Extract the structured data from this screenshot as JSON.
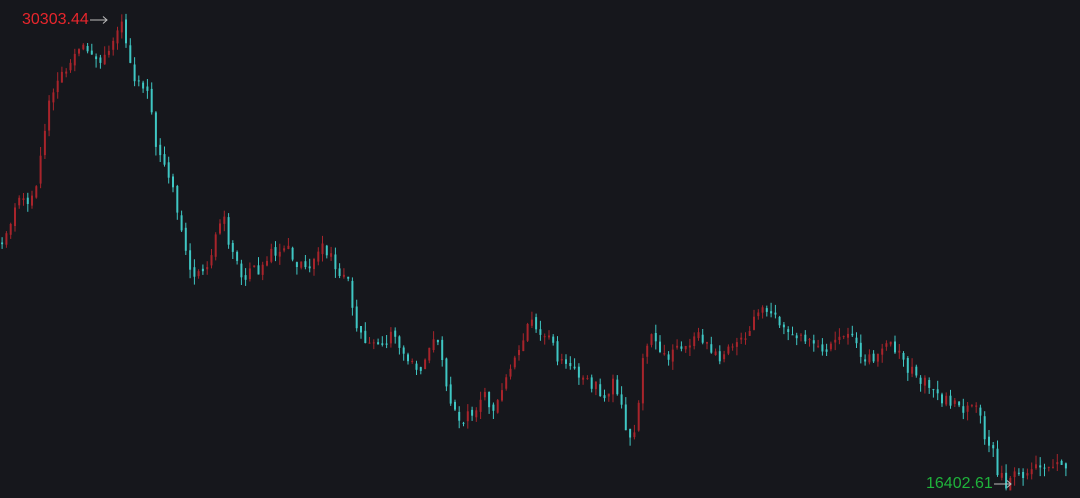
{
  "colors": {
    "background": "#16171c",
    "up": "#a8242b",
    "down": "#3fc7c4",
    "max_label": "#e8262c",
    "min_label": "#1fb33b",
    "arrow": "#bdbdbd"
  },
  "chart_data": {
    "type": "candlestick",
    "title": "",
    "xlabel": "",
    "ylabel": "",
    "grid": false,
    "axes_visible": false,
    "ylim": [
      16000,
      30600
    ],
    "max_label": "30303.44",
    "min_label": "16402.61",
    "close_path": [
      [
        0.0,
        23600
      ],
      [
        0.01,
        24300
      ],
      [
        0.018,
        25200
      ],
      [
        0.025,
        24700
      ],
      [
        0.033,
        25500
      ],
      [
        0.042,
        27600
      ],
      [
        0.05,
        28200
      ],
      [
        0.058,
        28700
      ],
      [
        0.066,
        29100
      ],
      [
        0.074,
        29500
      ],
      [
        0.082,
        29150
      ],
      [
        0.09,
        28900
      ],
      [
        0.098,
        29400
      ],
      [
        0.106,
        29900
      ],
      [
        0.112,
        30250
      ],
      [
        0.118,
        29300
      ],
      [
        0.124,
        28600
      ],
      [
        0.132,
        28400
      ],
      [
        0.14,
        27700
      ],
      [
        0.146,
        26400
      ],
      [
        0.152,
        26200
      ],
      [
        0.16,
        25400
      ],
      [
        0.168,
        24200
      ],
      [
        0.176,
        23100
      ],
      [
        0.184,
        22600
      ],
      [
        0.192,
        22900
      ],
      [
        0.2,
        23800
      ],
      [
        0.208,
        24400
      ],
      [
        0.216,
        23300
      ],
      [
        0.226,
        22700
      ],
      [
        0.238,
        22800
      ],
      [
        0.25,
        23200
      ],
      [
        0.262,
        23500
      ],
      [
        0.272,
        23300
      ],
      [
        0.282,
        22900
      ],
      [
        0.292,
        23100
      ],
      [
        0.3,
        23600
      ],
      [
        0.308,
        23200
      ],
      [
        0.316,
        22800
      ],
      [
        0.324,
        22600
      ],
      [
        0.332,
        21400
      ],
      [
        0.34,
        20800
      ],
      [
        0.352,
        20600
      ],
      [
        0.366,
        20900
      ],
      [
        0.378,
        20300
      ],
      [
        0.388,
        19800
      ],
      [
        0.398,
        20100
      ],
      [
        0.408,
        20800
      ],
      [
        0.416,
        19600
      ],
      [
        0.424,
        18600
      ],
      [
        0.432,
        18200
      ],
      [
        0.442,
        18700
      ],
      [
        0.452,
        19100
      ],
      [
        0.462,
        18800
      ],
      [
        0.472,
        19400
      ],
      [
        0.482,
        20200
      ],
      [
        0.49,
        20800
      ],
      [
        0.498,
        21300
      ],
      [
        0.506,
        21100
      ],
      [
        0.514,
        20700
      ],
      [
        0.524,
        20200
      ],
      [
        0.534,
        19800
      ],
      [
        0.544,
        19600
      ],
      [
        0.556,
        19400
      ],
      [
        0.568,
        19200
      ],
      [
        0.576,
        19700
      ],
      [
        0.584,
        18400
      ],
      [
        0.59,
        17600
      ],
      [
        0.596,
        18300
      ],
      [
        0.604,
        20600
      ],
      [
        0.612,
        20900
      ],
      [
        0.62,
        20400
      ],
      [
        0.628,
        20200
      ],
      [
        0.636,
        20500
      ],
      [
        0.646,
        20700
      ],
      [
        0.656,
        20800
      ],
      [
        0.666,
        20500
      ],
      [
        0.676,
        20300
      ],
      [
        0.686,
        20500
      ],
      [
        0.696,
        20700
      ],
      [
        0.706,
        21300
      ],
      [
        0.714,
        21600
      ],
      [
        0.722,
        21400
      ],
      [
        0.73,
        21300
      ],
      [
        0.738,
        21200
      ],
      [
        0.748,
        20900
      ],
      [
        0.758,
        20600
      ],
      [
        0.768,
        20400
      ],
      [
        0.778,
        20500
      ],
      [
        0.788,
        20800
      ],
      [
        0.798,
        20900
      ],
      [
        0.806,
        20400
      ],
      [
        0.816,
        20100
      ],
      [
        0.826,
        20300
      ],
      [
        0.836,
        20600
      ],
      [
        0.846,
        20200
      ],
      [
        0.856,
        19800
      ],
      [
        0.866,
        19500
      ],
      [
        0.876,
        19200
      ],
      [
        0.886,
        19000
      ],
      [
        0.896,
        18900
      ],
      [
        0.906,
        18700
      ],
      [
        0.914,
        19100
      ],
      [
        0.92,
        18300
      ],
      [
        0.926,
        17700
      ],
      [
        0.932,
        17300
      ],
      [
        0.938,
        16700
      ],
      [
        0.944,
        16500
      ],
      [
        0.95,
        16600
      ],
      [
        0.958,
        16750
      ],
      [
        0.966,
        16900
      ],
      [
        0.974,
        16950
      ],
      [
        0.984,
        17050
      ]
    ]
  }
}
